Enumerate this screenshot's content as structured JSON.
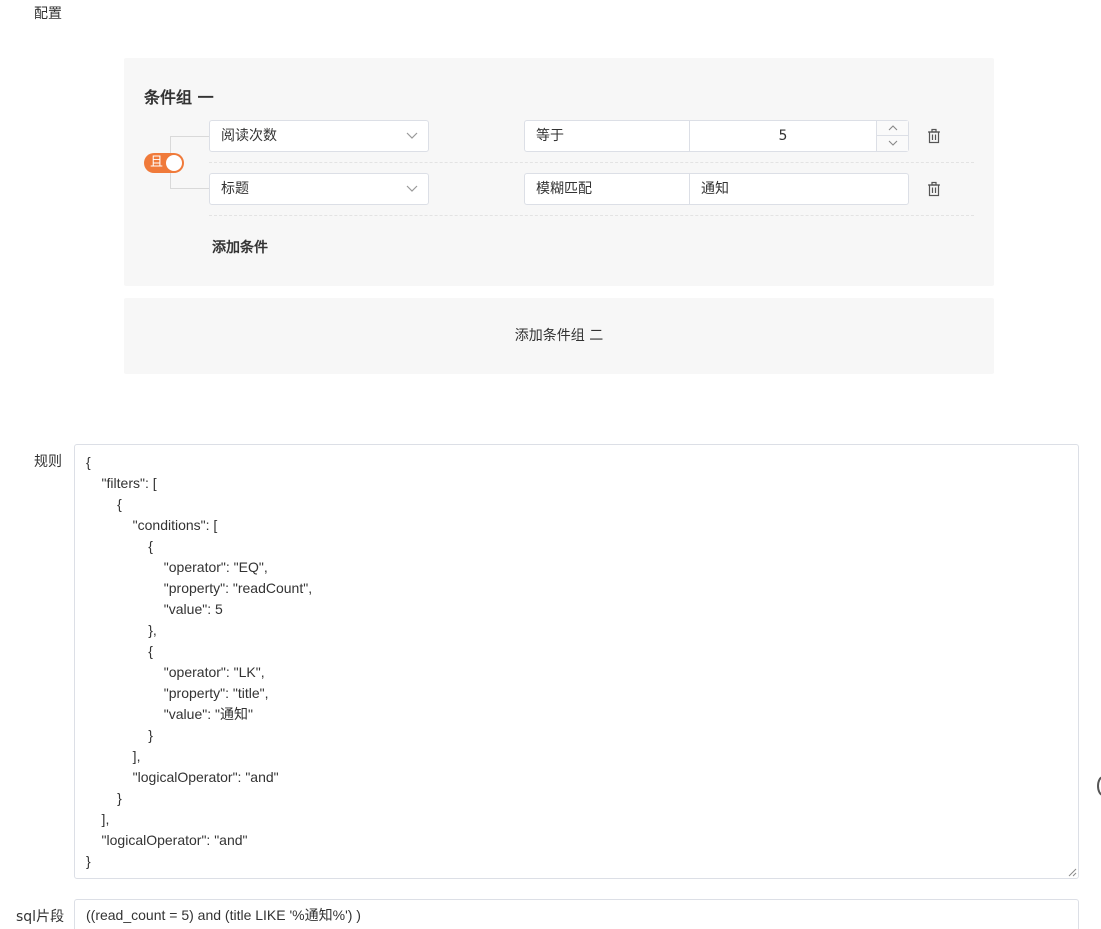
{
  "labels": {
    "config": "配置",
    "rules": "规则",
    "sql": "sql片段"
  },
  "group": {
    "title": "条件组 一",
    "logic_label": "且",
    "rows": [
      {
        "field": "阅读次数",
        "operator": "等于",
        "value": "5",
        "stepper": true
      },
      {
        "field": "标题",
        "operator": "模糊匹配",
        "value": "通知",
        "stepper": false
      }
    ],
    "add_condition": "添加条件"
  },
  "add_group": "添加条件组 二",
  "rules_json": "{\n    \"filters\": [\n        {\n            \"conditions\": [\n                {\n                    \"operator\": \"EQ\",\n                    \"property\": \"readCount\",\n                    \"value\": 5\n                },\n                {\n                    \"operator\": \"LK\",\n                    \"property\": \"title\",\n                    \"value\": \"通知\"\n                }\n            ],\n            \"logicalOperator\": \"and\"\n        }\n    ],\n    \"logicalOperator\": \"and\"\n}",
  "sql": "((read_count = 5) and (title LIKE '%通知%') )",
  "colors": {
    "accent": "#f07a3a",
    "card_bg": "#f7f7f7",
    "border": "#dcdfe6"
  },
  "icons": {
    "select_arrow": "chevron-down-icon",
    "delete": "trash-icon",
    "increment": "chevron-up-icon",
    "decrement": "chevron-down-icon"
  }
}
